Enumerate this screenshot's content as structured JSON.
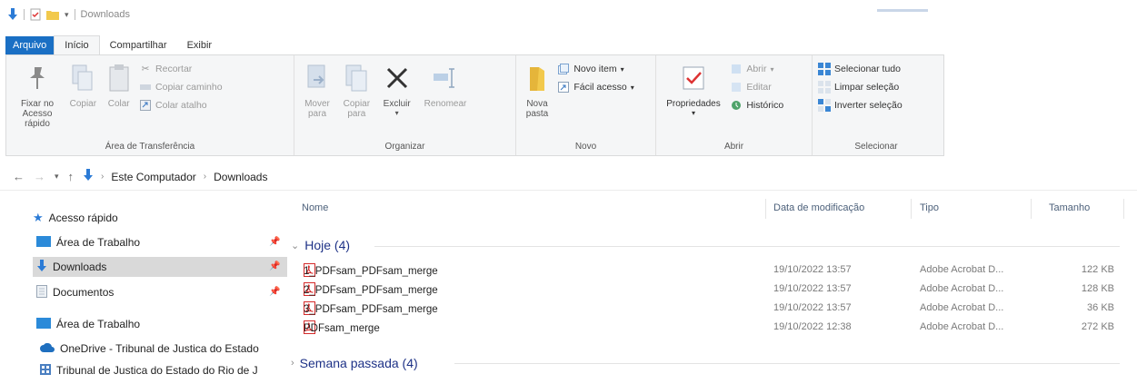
{
  "window": {
    "title": "Downloads"
  },
  "ribbon_tabs": [
    "Arquivo",
    "Início",
    "Compartilhar",
    "Exibir"
  ],
  "ribbon": {
    "clipboard": {
      "label": "Área de Transferência",
      "pin": "Fixar no Acesso rápido",
      "copy": "Copiar",
      "paste": "Colar",
      "cut": "Recortar",
      "copy_path": "Copiar caminho",
      "paste_shortcut": "Colar atalho"
    },
    "organize": {
      "label": "Organizar",
      "move_to": "Mover para",
      "copy_to": "Copiar para",
      "delete": "Excluir",
      "rename": "Renomear"
    },
    "new": {
      "label": "Novo",
      "new_folder": "Nova pasta",
      "new_item": "Novo item",
      "easy_access": "Fácil acesso"
    },
    "open": {
      "label": "Abrir",
      "properties": "Propriedades",
      "open": "Abrir",
      "edit": "Editar",
      "history": "Histórico"
    },
    "select": {
      "label": "Selecionar",
      "select_all": "Selecionar tudo",
      "select_none": "Limpar seleção",
      "invert": "Inverter seleção"
    }
  },
  "address": {
    "crumbs": [
      "Este Computador",
      "Downloads"
    ]
  },
  "nav": {
    "quick_access": "Acesso rápido",
    "items": [
      "Área de Trabalho",
      "Downloads",
      "Documentos"
    ],
    "desktop": "Área de Trabalho",
    "onedrive": "OneDrive - Tribunal de Justica do Estado",
    "tribunal": "Tribunal de Justica do Estado do Rio de J"
  },
  "columns": [
    "Nome",
    "Data de modificação",
    "Tipo",
    "Tamanho"
  ],
  "groups": [
    {
      "label": "Hoje (4)",
      "files": [
        {
          "name": "1_PDFsam_PDFsam_merge",
          "date": "19/10/2022 13:57",
          "type": "Adobe Acrobat D...",
          "size": "122 KB"
        },
        {
          "name": "2_PDFsam_PDFsam_merge",
          "date": "19/10/2022 13:57",
          "type": "Adobe Acrobat D...",
          "size": "128 KB"
        },
        {
          "name": "3_PDFsam_PDFsam_merge",
          "date": "19/10/2022 13:57",
          "type": "Adobe Acrobat D...",
          "size": "36 KB"
        },
        {
          "name": "PDFsam_merge",
          "date": "19/10/2022 12:38",
          "type": "Adobe Acrobat D...",
          "size": "272 KB"
        }
      ]
    },
    {
      "label": "Semana passada (4)"
    }
  ],
  "colors": {
    "file_tab": "#1a6fc4",
    "group_header": "#1e3287",
    "pdf_red": "#d42a2a",
    "folder_blue": "#2b8ad9"
  }
}
